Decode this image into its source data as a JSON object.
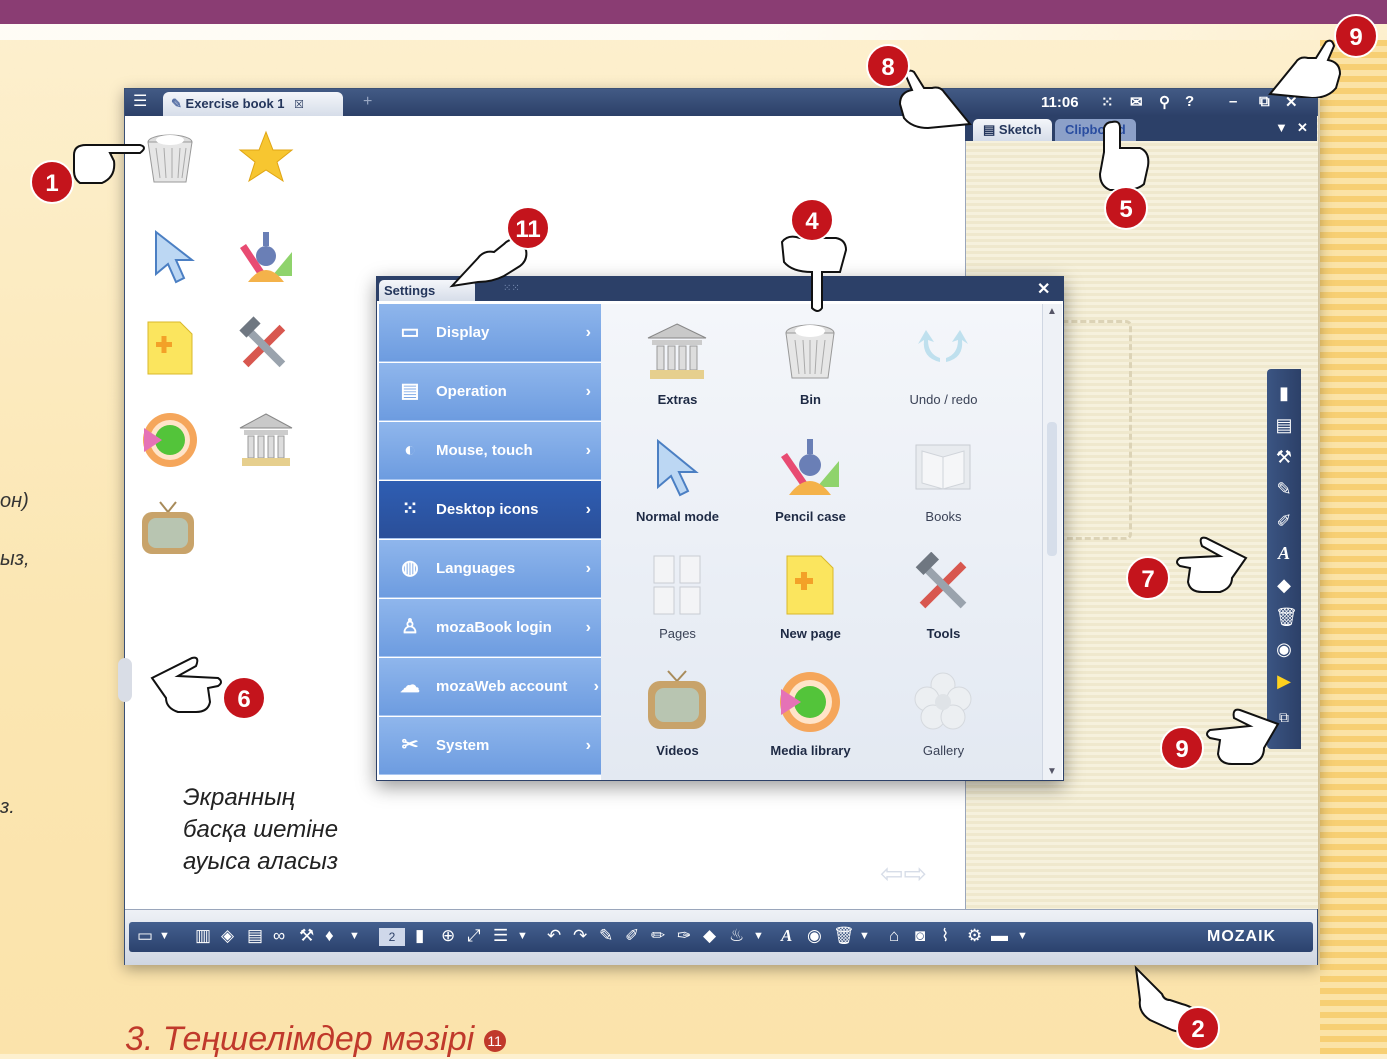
{
  "page": {
    "side_texts": [
      "он)",
      "ыз,",
      "з."
    ],
    "caption_text": "3. Теңшелімдер мәзірі",
    "caption_badge": "11",
    "screen_note": [
      "Экранның",
      "басқа шетіне",
      "ауыса аласыз"
    ]
  },
  "titlebar": {
    "tab_label": "Exercise book 1",
    "tab_close": "☒",
    "plus": "+",
    "clock": "11:06",
    "icons": [
      "apps-icon",
      "mail-icon",
      "search-icon",
      "help-icon",
      "minimize-icon",
      "popout-icon",
      "close-icon"
    ],
    "icon_glyphs": [
      "⁙",
      "✉",
      "⚲",
      "?",
      "–",
      "⧉",
      "✕"
    ]
  },
  "right_panel": {
    "tabs": [
      "Sketch",
      "Clipboard"
    ],
    "controls": [
      "▼",
      "✕"
    ]
  },
  "settings": {
    "title": "Settings",
    "close": "✕",
    "menu": [
      {
        "label": "Display",
        "icon": "monitor-icon",
        "glyph": "▭"
      },
      {
        "label": "Operation",
        "icon": "window-icon",
        "glyph": "▤"
      },
      {
        "label": "Mouse, touch",
        "icon": "mouse-icon",
        "glyph": "◐"
      },
      {
        "label": "Desktop icons",
        "icon": "desktop-icons-icon",
        "glyph": "⁙"
      },
      {
        "label": "Languages",
        "icon": "globe-icon",
        "glyph": "◍"
      },
      {
        "label": "mozaBook login",
        "icon": "user-icon",
        "glyph": "♙"
      },
      {
        "label": "mozaWeb account",
        "icon": "cloud-user-icon",
        "glyph": "☁"
      },
      {
        "label": "System",
        "icon": "system-icon",
        "glyph": "✂"
      }
    ],
    "chevron": "›",
    "active_index": 3,
    "grid": [
      {
        "label": "Extras",
        "icon": "museum-icon"
      },
      {
        "label": "Bin",
        "icon": "bin-icon"
      },
      {
        "label": "Undo / redo",
        "icon": "undo-redo-icon"
      },
      {
        "label": "Normal mode",
        "icon": "cursor-icon"
      },
      {
        "label": "Pencil case",
        "icon": "pencil-case-icon"
      },
      {
        "label": "Books",
        "icon": "books-icon"
      },
      {
        "label": "Pages",
        "icon": "pages-icon"
      },
      {
        "label": "New page",
        "icon": "new-page-icon"
      },
      {
        "label": "Tools",
        "icon": "tools-icon"
      },
      {
        "label": "Videos",
        "icon": "tv-icon"
      },
      {
        "label": "Media library",
        "icon": "media-library-icon"
      },
      {
        "label": "Gallery",
        "icon": "gallery-icon"
      }
    ]
  },
  "toolbar": {
    "page_number": "2",
    "brand": "MOZAIK"
  },
  "badges": [
    "1",
    "2",
    "4",
    "5",
    "6",
    "7",
    "8",
    "9",
    "9",
    "11"
  ],
  "colors": {
    "accent": "#2c4068",
    "badge": "#c4141c",
    "menu_active": "#2f5eb3"
  }
}
